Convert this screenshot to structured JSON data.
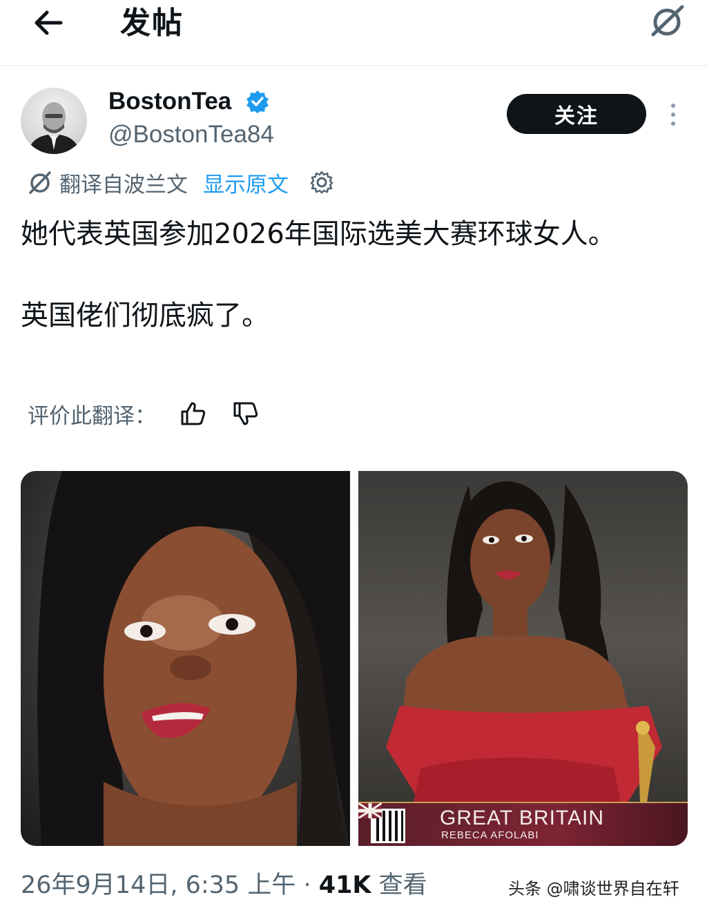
{
  "header": {
    "back_icon": "arrow-left-icon",
    "title": "发帖",
    "grok_icon": "grok-icon"
  },
  "author": {
    "display_name": "BostonTea",
    "handle": "@BostonTea84",
    "verified": true,
    "follow_label": "关注",
    "more_icon": "more-vertical-icon"
  },
  "translation": {
    "icon": "translate-icon",
    "translated_from": "翻译自波兰文",
    "show_original": "显示原文",
    "settings_icon": "gear-icon"
  },
  "post": {
    "paragraph_1": "她代表英国参加2026年国际选美大赛环球女人。",
    "paragraph_2": "英国佬们彻底疯了。"
  },
  "rating": {
    "label": "评价此翻译：",
    "like_icon": "thumbs-up-icon",
    "dislike_icon": "thumbs-down-icon"
  },
  "media": {
    "banner_country": "GREAT BRITAIN",
    "banner_name": "REBECA AFOLABI"
  },
  "footer": {
    "timestamp": "26年9月14日, 6:35 上午",
    "separator": " · ",
    "views_count": "41K",
    "views_label": " 查看",
    "watermark": "头条 @啸谈世界自在轩"
  },
  "colors": {
    "accent": "#1d9bf0",
    "text": "#0f1419",
    "secondary": "#536471",
    "follow_bg": "#0f1419"
  }
}
